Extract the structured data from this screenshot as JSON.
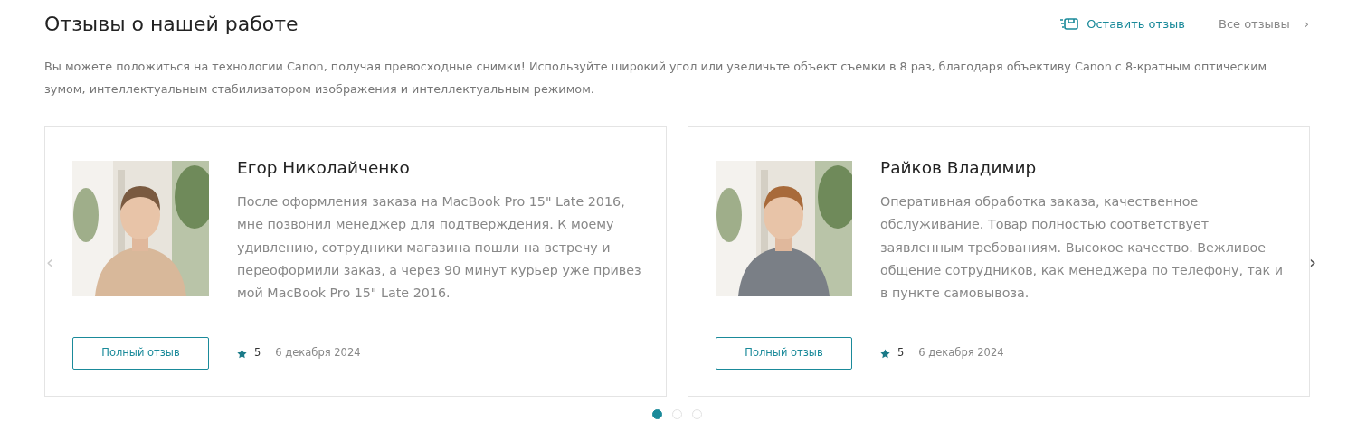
{
  "header": {
    "title": "Отзывы о нашей работе",
    "write_link": "Оставить отзыв",
    "all_link": "Все отзывы",
    "all_arrow": "›"
  },
  "description": "Вы можете положиться на технологии Canon, получая превосходные снимки! Используйте широкий угол или увеличьте объект съемки в 8 раз, благодаря объективу Canon с 8-кратным оптическим зумом, интеллектуальным стабилизатором изображения и интеллектуальным режимом.",
  "carousel": {
    "prev": {
      "label": "‹",
      "disabled": true
    },
    "next": {
      "label": "›",
      "disabled": false
    },
    "reviews": [
      {
        "name": "Егор Николайченко",
        "text": "После оформления заказа на MacBook Pro 15\" Late 2016, мне позвонил менеджер для подтверждения. К моему удивлению, сотрудники магазина пошли на встречу и переоформили заказ, а через 90 минут курьер уже привез мой MacBook Pro 15\" Late 2016.",
        "button": "Полный отзыв",
        "rating": "5",
        "date": "6 декабря 2024"
      },
      {
        "name": "Райков Владимир",
        "text": "Оперативная обработка заказа, качественное обслуживание. Товар полностью соответствует заявленным требованиям. Высокое качество. Вежливое общение сотрудников, как менеджера по телефону, так и в пункте самовывоза.",
        "button": "Полный отзыв",
        "rating": "5",
        "date": "6 декабря 2024"
      }
    ],
    "pages": [
      {
        "selected": true
      },
      {
        "selected": false
      },
      {
        "selected": false
      }
    ]
  }
}
